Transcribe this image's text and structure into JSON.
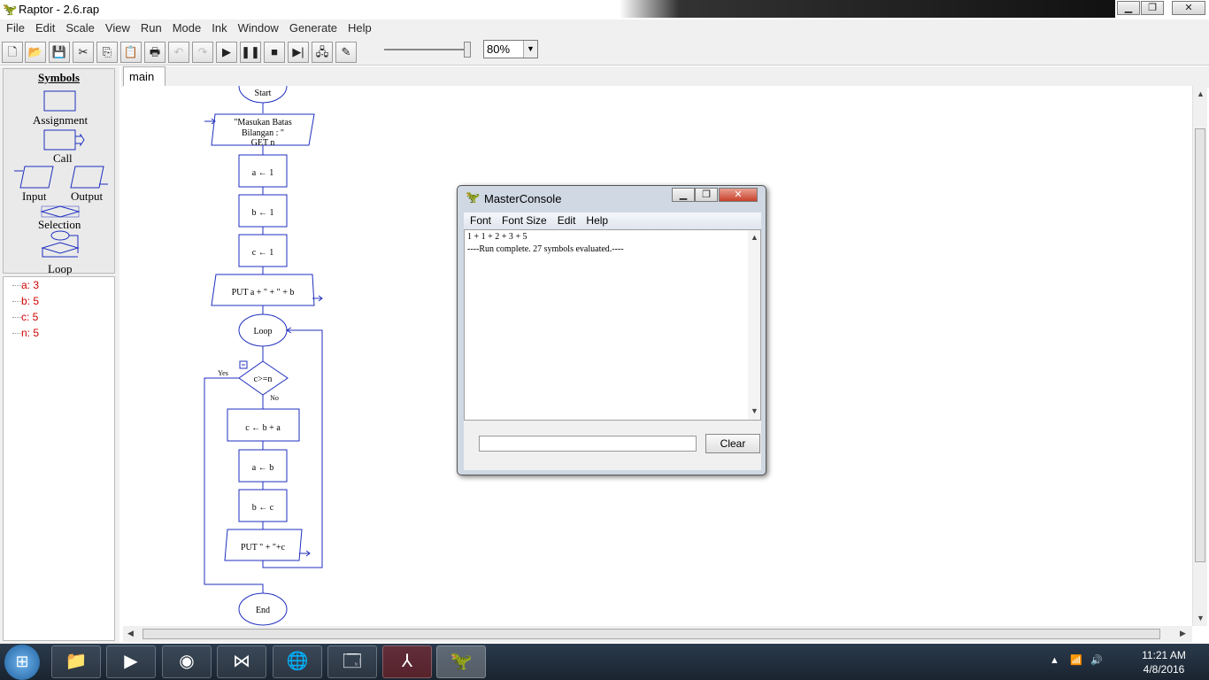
{
  "window": {
    "title": "Raptor - 2.6.rap"
  },
  "menu": [
    "File",
    "Edit",
    "Scale",
    "View",
    "Run",
    "Mode",
    "Ink",
    "Window",
    "Generate",
    "Help"
  ],
  "toolbar": {
    "zoom": "80%",
    "speed_level": 1.0
  },
  "symbols": {
    "title": "Symbols",
    "items": [
      "Assignment",
      "Call",
      "Input",
      "Output",
      "Selection",
      "Loop"
    ]
  },
  "watch": [
    {
      "label": "a: 3"
    },
    {
      "label": "b: 5"
    },
    {
      "label": "c: 5"
    },
    {
      "label": "n: 5"
    }
  ],
  "tab": {
    "label": "main"
  },
  "flowchart": {
    "start": "Start",
    "input_prompt": "\"Masukan Batas",
    "input_prompt2": "Bilangan : \"",
    "input_get": "GET n",
    "assign1": "a ← 1",
    "assign2": "b ← 1",
    "assign3": "c ← 1",
    "output1": "PUT a + \" + \" + b",
    "loop": "Loop",
    "condition": "c>=n",
    "yes": "Yes",
    "no": "No",
    "assign4": "c ← b + a",
    "assign5": "a ← b",
    "assign6": "b ← c",
    "output2": "PUT \" + \"+c",
    "end": "End"
  },
  "console": {
    "title": "MasterConsole",
    "menu": [
      "Font",
      "Font Size",
      "Edit",
      "Help"
    ],
    "lines": [
      "1 + 1 + 2 + 3 + 5",
      "----Run complete.  27 symbols evaluated.----"
    ],
    "clear_label": "Clear"
  },
  "taskbar": {
    "time": "11:21 AM",
    "date": "4/8/2016"
  }
}
